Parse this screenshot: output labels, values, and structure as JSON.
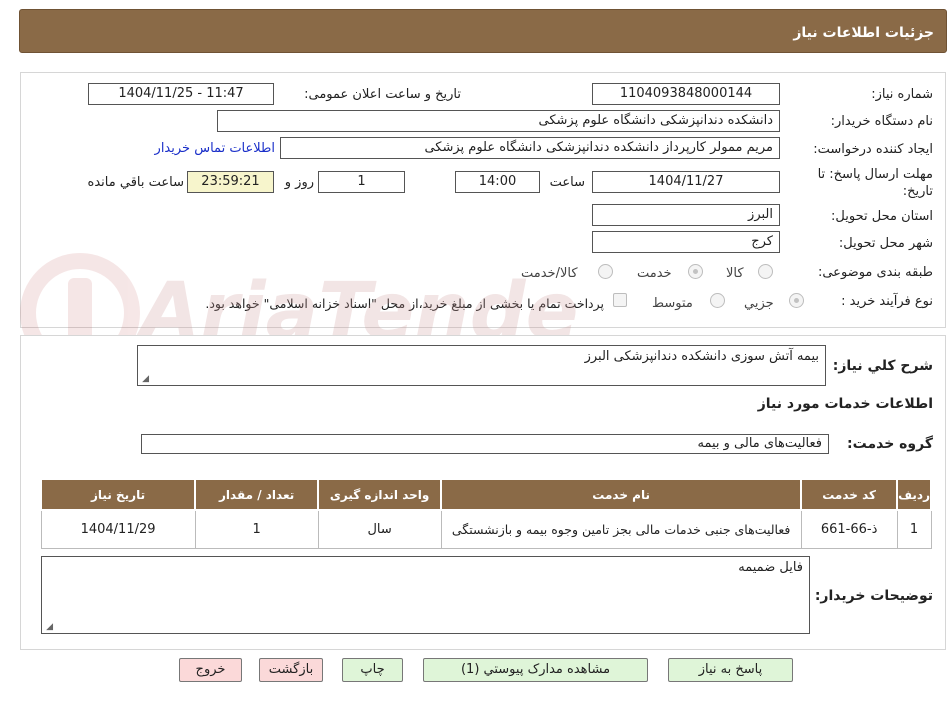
{
  "header": {
    "title": "جزئیات اطلاعات نیاز"
  },
  "form": {
    "need_number_label": "شماره نیاز:",
    "need_number": "1104093848000144",
    "announce_label": "تاریخ و ساعت اعلان عمومی:",
    "announce_value": "1404/11/25 - 11:47",
    "buyer_org_label": "نام دستگاه خریدار:",
    "buyer_org": "دانشکده دندانپزشکی دانشگاه علوم پزشکی",
    "requester_label": "ایجاد کننده درخواست:",
    "requester": "مریم ممولر کارپرداز دانشکده دندانپزشکی دانشگاه علوم پزشکی",
    "contact_link": "اطلاعات تماس خریدار",
    "deadline_label_1": "مهلت ارسال پاسخ: تا",
    "deadline_label_2": "تاریخ:",
    "deadline_date": "1404/11/27",
    "time_label": "ساعت",
    "deadline_time": "14:00",
    "days_value": "1",
    "days_label": "روز و",
    "remaining_time": "23:59:21",
    "remaining_label": "ساعت باقي مانده",
    "province_label": "استان محل تحویل:",
    "province": "البرز",
    "city_label": "شهر محل تحویل:",
    "city": "کرج",
    "category_label": "طبقه بندی موضوعی:",
    "category_options": [
      "کالا",
      "خدمت",
      "کالا/خدمت"
    ],
    "category_selected": "خدمت",
    "purchase_type_label": "نوع فرآیند خرید :",
    "purchase_options": [
      "جزیي",
      "متوسط"
    ],
    "purchase_selected": "جزیي",
    "payment_note": "پرداخت تمام یا بخشی از مبلغ خرید،از محل \"اسناد خزانه اسلامی\" خواهد بود."
  },
  "summary": {
    "label": "شرح کلي نیاز:",
    "value": "بیمه آتش سوزی دانشکده دندانپزشکی البرز",
    "services_heading": "اطلاعات خدمات مورد نیاز",
    "group_label": "گروه خدمت:",
    "group_value": "فعالیت‌های مالی و بیمه"
  },
  "table": {
    "headers": [
      "ردیف",
      "کد خدمت",
      "نام خدمت",
      "واحد اندازه گیری",
      "تعداد / مقدار",
      "تاریخ نیاز"
    ],
    "rows": [
      [
        "1",
        "ذ-66-661",
        "فعالیت‌های جنبی خدمات مالی بجز تامین وجوه بیمه و بازنشستگی",
        "سال",
        "1",
        "1404/11/29"
      ]
    ]
  },
  "buyer_notes": {
    "label": "توضیحات خریدار:",
    "value": "فایل ضمیمه"
  },
  "buttons": {
    "reply": "پاسخ به نیاز",
    "attachments": "مشاهده مدارک پیوستي (1)",
    "print": "چاپ",
    "back": "بازگشت",
    "exit": "خروج"
  },
  "watermark": {
    "text": "AriaTender.net"
  },
  "colors": {
    "header": "#8a6a47",
    "button_green": "#dff5d8",
    "button_pink": "#fbd9d9",
    "highlight": "#f7f5cc",
    "link": "#1a2fc9"
  }
}
